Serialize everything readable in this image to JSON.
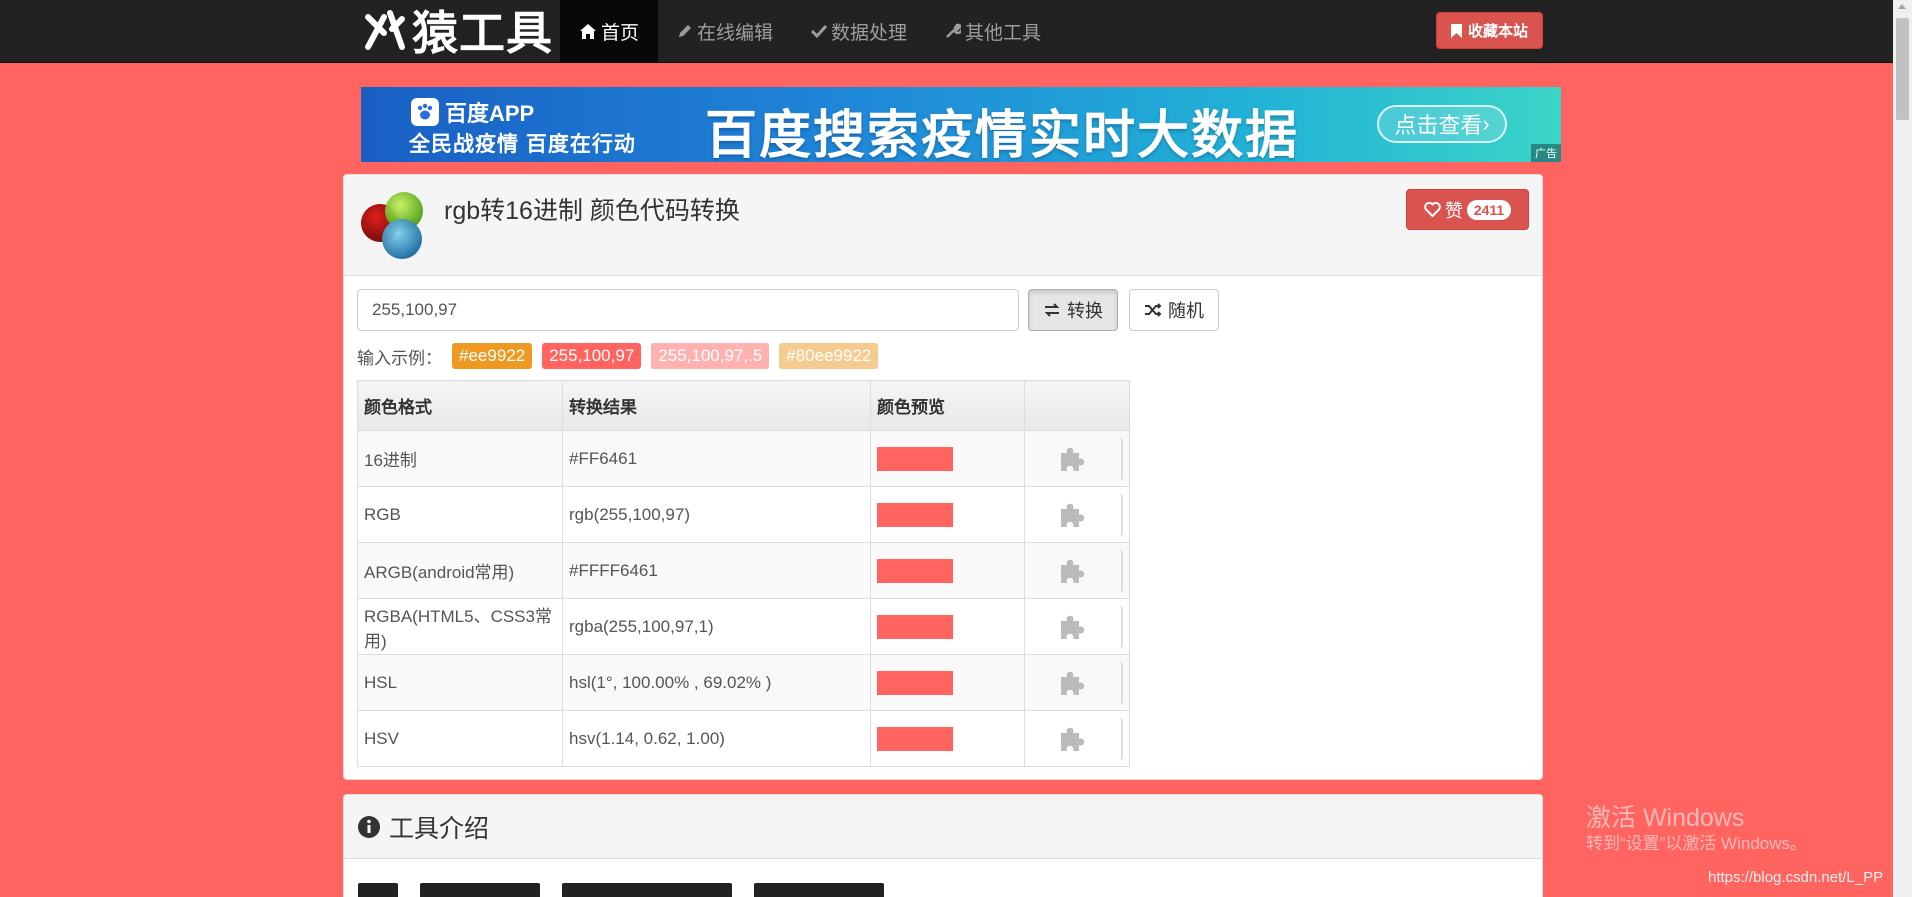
{
  "navbar": {
    "logo_text": "猿工具",
    "items": [
      {
        "label": "首页",
        "icon": "home-icon",
        "active": true
      },
      {
        "label": "在线编辑",
        "icon": "pencil-icon",
        "active": false
      },
      {
        "label": "数据处理",
        "icon": "check-icon",
        "active": false
      },
      {
        "label": "其他工具",
        "icon": "wrench-icon",
        "active": false
      }
    ],
    "favorite_label": "收藏本站"
  },
  "banner": {
    "app_name": "百度APP",
    "slogan": "全民战疫情 百度在行动",
    "headline": "百度搜索疫情实时大数据",
    "cta": "点击查看",
    "ad_tag": "广告"
  },
  "tool": {
    "title": "rgb转16进制 颜色代码转换",
    "like_label": "赞",
    "like_count": "2411",
    "input_value": "255,100,97",
    "convert_label": "转换",
    "random_label": "随机",
    "examples_label": "输入示例：",
    "examples": [
      {
        "text": "#ee9922",
        "color": "#ee9922"
      },
      {
        "text": "255,100,97",
        "color": "#ff6461"
      },
      {
        "text": "255,100,97,.5",
        "color": "#ffb1b0"
      },
      {
        "text": "#80ee9922",
        "color": "#f5cb8f"
      }
    ]
  },
  "table": {
    "headers": [
      "颜色格式",
      "转换结果",
      "颜色预览",
      ""
    ],
    "preview_color": "#ff6461",
    "rows": [
      {
        "format": "16进制",
        "result": "#FF6461"
      },
      {
        "format": "RGB",
        "result": "rgb(255,100,97)"
      },
      {
        "format": "ARGB(android常用)",
        "result": "#FFFF6461"
      },
      {
        "format": "RGBA(HTML5、CSS3常用)",
        "result": "rgba(255,100,97,1)"
      },
      {
        "format": "HSL",
        "result": "hsl(1°, 100.00% , 69.02% )"
      },
      {
        "format": "HSV",
        "result": "hsv(1.14, 0.62, 1.00)"
      }
    ]
  },
  "intro": {
    "title": "工具介绍",
    "icon": "info-icon"
  },
  "watermark": {
    "line1": "激活 Windows",
    "line2": "转到“设置”以激活 Windows。",
    "url": "https://blog.csdn.net/L_PP"
  },
  "colors": {
    "page_bg": "#ff6461",
    "navbar_bg": "#222222",
    "danger": "#d9534f"
  }
}
